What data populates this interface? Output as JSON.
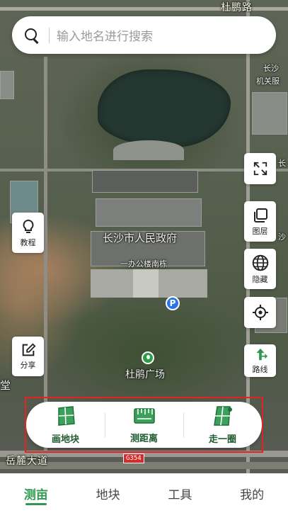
{
  "map": {
    "labels": {
      "dupeng_road": "杜鹏路",
      "changsha_org": "长沙",
      "changsha_org2": "机关服",
      "gov": "长沙市人民政府",
      "gov_building": "一办公楼南栋",
      "park": "杜鹃广场",
      "yuelu_road": "岳麓大道",
      "route": "G354",
      "left_edge": "堂",
      "right_edge1": "长",
      "right_edge2": "沙"
    },
    "parking_symbol": "P"
  },
  "search": {
    "placeholder": "输入地名进行搜索",
    "icon": "search-icon"
  },
  "side_tools": {
    "tutorial": {
      "label": "教程",
      "icon": "lightbulb-icon"
    },
    "share": {
      "label": "分享",
      "icon": "edit-share-icon"
    },
    "fullscreen": {
      "label": "",
      "icon": "fullscreen-icon"
    },
    "layers": {
      "label": "图层",
      "icon": "layers-icon"
    },
    "hide": {
      "label": "隐藏",
      "icon": "globe-icon"
    },
    "locate": {
      "label": "",
      "icon": "locate-icon"
    },
    "route": {
      "label": "路线",
      "icon": "route-arrow-icon"
    }
  },
  "actions": [
    {
      "label": "画地块",
      "icon": "draw-plot-icon"
    },
    {
      "label": "测距离",
      "icon": "ruler-icon"
    },
    {
      "label": "走一圈",
      "icon": "walk-loop-icon"
    }
  ],
  "tabs": [
    {
      "label": "测亩",
      "active": true
    },
    {
      "label": "地块",
      "active": false
    },
    {
      "label": "工具",
      "active": false
    },
    {
      "label": "我的",
      "active": false
    }
  ],
  "colors": {
    "accent": "#2f9a4f",
    "highlight": "#e02424"
  }
}
